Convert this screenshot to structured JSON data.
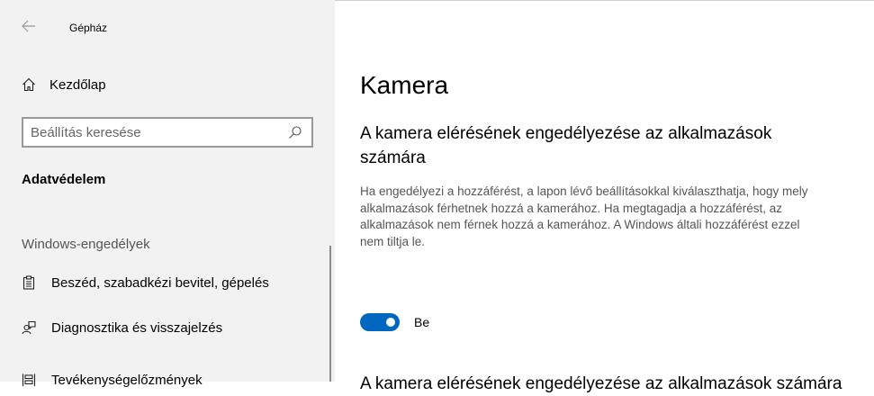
{
  "window": {
    "title": "Gépház"
  },
  "sidebar": {
    "home_label": "Kezdőlap",
    "search_placeholder": "Beállítás keresése",
    "section_title": "Adatvédelem",
    "group_label": "Windows-engedélyek",
    "items": [
      {
        "label": "Beszéd, szabadkézi bevitel, gépelés",
        "icon": "clipboard-icon"
      },
      {
        "label": "Diagnosztika és visszajelzés",
        "icon": "feedback-icon"
      },
      {
        "label": "Tevékenységelőzmények",
        "icon": "timeline-icon"
      }
    ]
  },
  "main": {
    "page_title": "Kamera",
    "heading": "A kamera elérésének engedélyezése az alkalmazások számára",
    "description": "Ha engedélyezi a hozzáférést, a lapon lévő beállításokkal kiválaszthatja, hogy mely alkalmazások férhetnek hozzá a kamerához. Ha megtagadja a hozzáférést, az alkalmazások nem férnek hozzá a kamerához. A Windows általi hozzáférést ezzel nem tiltja le.",
    "toggle": {
      "label": "Be",
      "state": "on"
    },
    "heading2": "A kamera elérésének engedélyezése az alkalmazások számára"
  },
  "colors": {
    "accent": "#0067c0",
    "sidebar_bg": "#f2f2f2"
  }
}
